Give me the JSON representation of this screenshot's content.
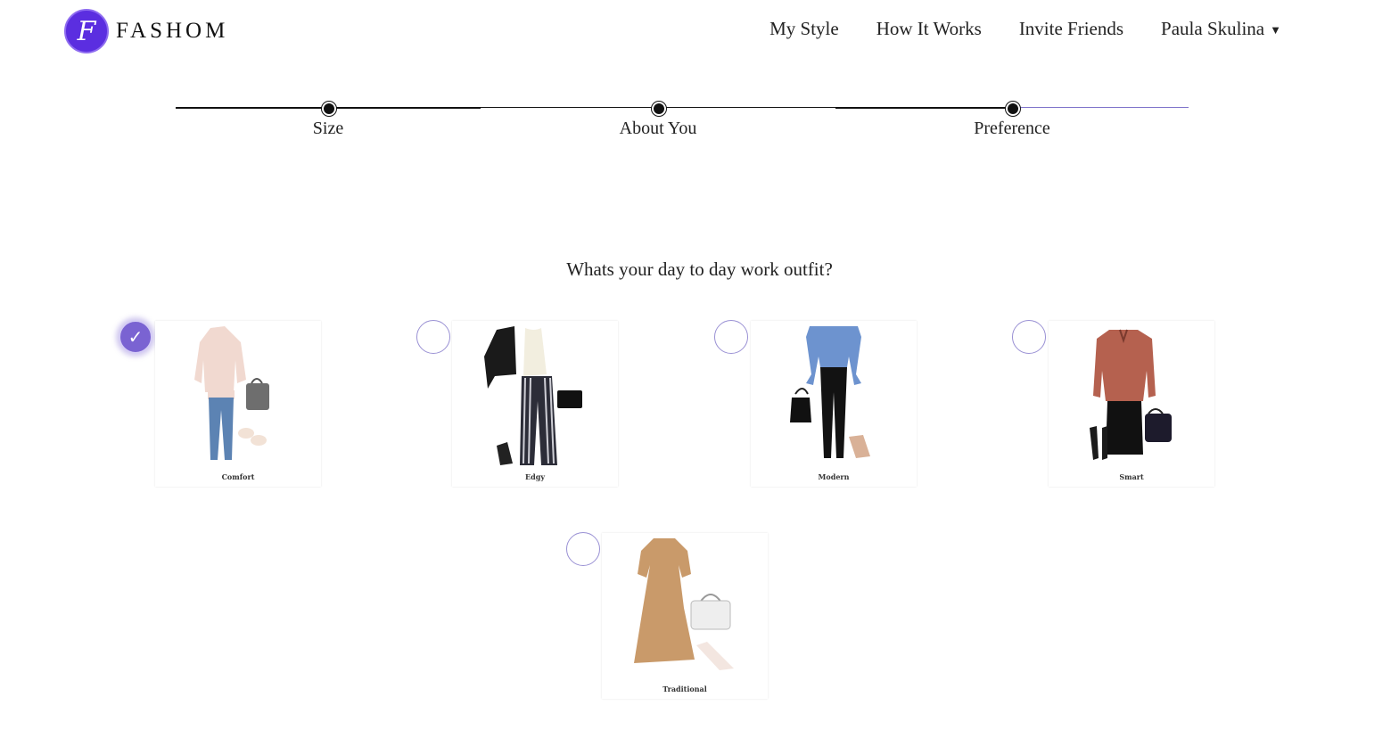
{
  "brand": {
    "logo_letter": "F",
    "name": "FASHOM",
    "color": "#5b2ee0"
  },
  "nav": {
    "items": [
      "My Style",
      "How It Works",
      "Invite Friends"
    ],
    "user_name": "Paula Skulina"
  },
  "stepper": {
    "steps": [
      {
        "label": "Size"
      },
      {
        "label": "About You"
      },
      {
        "label": "Preference"
      }
    ]
  },
  "question": "Whats your day to day work outfit?",
  "options": [
    {
      "label": "Comfort",
      "selected": true
    },
    {
      "label": "Edgy",
      "selected": false
    },
    {
      "label": "Modern",
      "selected": false
    },
    {
      "label": "Smart",
      "selected": false
    },
    {
      "label": "Traditional",
      "selected": false
    }
  ],
  "colors": {
    "accent": "#7a63d2",
    "radio_border": "#9a91d4"
  }
}
